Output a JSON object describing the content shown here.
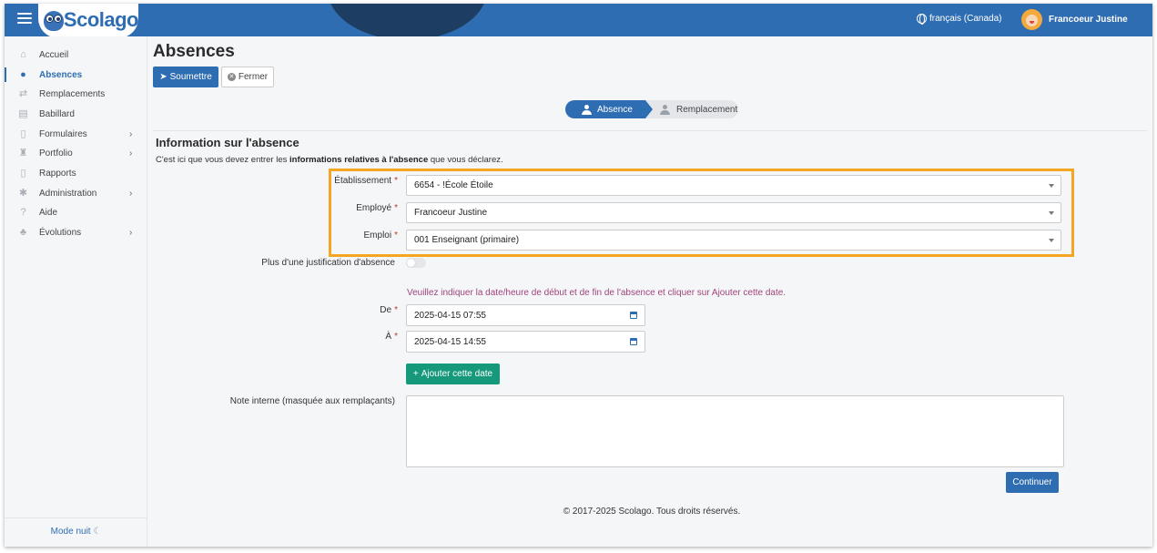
{
  "header": {
    "logo_text": "Scolago",
    "language": "français (Canada)",
    "user_name": "Francoeur Justine"
  },
  "sidebar": {
    "items": [
      {
        "label": "Accueil",
        "icon": "home-icon",
        "active": false,
        "has_chevron": false
      },
      {
        "label": "Absences",
        "icon": "user-absence-icon",
        "active": true,
        "has_chevron": false
      },
      {
        "label": "Remplacements",
        "icon": "replacement-icon",
        "active": false,
        "has_chevron": false
      },
      {
        "label": "Babillard",
        "icon": "board-icon",
        "active": false,
        "has_chevron": false
      },
      {
        "label": "Formulaires",
        "icon": "form-icon",
        "active": false,
        "has_chevron": true
      },
      {
        "label": "Portfolio",
        "icon": "trophy-icon",
        "active": false,
        "has_chevron": true
      },
      {
        "label": "Rapports",
        "icon": "report-icon",
        "active": false,
        "has_chevron": false
      },
      {
        "label": "Administration",
        "icon": "gear-icon",
        "active": false,
        "has_chevron": true
      },
      {
        "label": "Aide",
        "icon": "question-icon",
        "active": false,
        "has_chevron": false
      },
      {
        "label": "Évolutions",
        "icon": "sprout-icon",
        "active": false,
        "has_chevron": true
      }
    ],
    "night_mode": "Mode nuit"
  },
  "page": {
    "title": "Absences",
    "submit_label": "Soumettre",
    "close_label": "Fermer"
  },
  "stepper": {
    "step1": "Absence",
    "step2": "Remplacement"
  },
  "section": {
    "title": "Information sur l'absence",
    "intro_before": "C'est ici que vous devez entrer les ",
    "intro_bold": "informations relatives à l'absence",
    "intro_after": " que vous déclarez."
  },
  "form": {
    "etablissement_label": "Établissement",
    "etablissement_value": "6654 - !École Étoile",
    "employe_label": "Employé",
    "employe_value": "Francoeur Justine",
    "emploi_label": "Emploi",
    "emploi_value": "001 Enseignant (primaire)",
    "justification_label": "Plus d'une justification d'absence",
    "justification_on": false,
    "hint": "Veuillez indiquer la date/heure de début et de fin de l'absence et cliquer sur Ajouter cette date.",
    "de_label": "De",
    "de_value": "2025-04-15 07:55",
    "a_label": "À",
    "a_value": "2025-04-15 14:55",
    "add_date_label": "Ajouter cette date",
    "note_label": "Note interne (masquée aux remplaçants)",
    "note_value": "",
    "required_mark": "*",
    "continue_label": "Continuer"
  },
  "footer": {
    "copyright": "© 2017-2025 Scolago. Tous droits réservés."
  },
  "colors": {
    "primary": "#2f6db2",
    "success": "#16997b",
    "highlight": "#f4a623",
    "hint": "#a0447b"
  }
}
